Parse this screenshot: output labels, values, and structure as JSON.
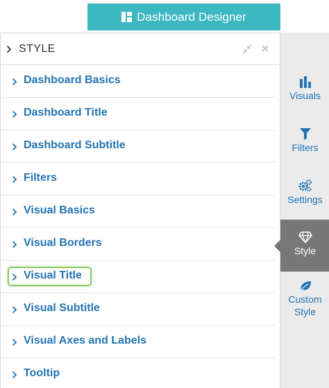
{
  "header": {
    "designer_label": "Dashboard Designer",
    "accent_color": "#3cb8c1"
  },
  "panel": {
    "title": "STYLE",
    "sections": [
      {
        "label": "Dashboard Basics"
      },
      {
        "label": "Dashboard Title"
      },
      {
        "label": "Dashboard Subtitle"
      },
      {
        "label": "Filters"
      },
      {
        "label": "Visual Basics"
      },
      {
        "label": "Visual Borders"
      },
      {
        "label": "Visual Title"
      },
      {
        "label": "Visual Subtitle"
      },
      {
        "label": "Visual Axes and Labels"
      },
      {
        "label": "Tooltip"
      }
    ],
    "highlighted_section": "Visual Title",
    "link_color": "#2374b3"
  },
  "nav": {
    "items": [
      {
        "label": "Visuals",
        "icon": "bar-chart-icon"
      },
      {
        "label": "Filters",
        "icon": "funnel-icon"
      },
      {
        "label": "Settings",
        "icon": "gears-icon"
      },
      {
        "label": "Style",
        "icon": "diamond-icon",
        "active": true
      },
      {
        "label": "Custom Style",
        "icon": "leaf-icon"
      }
    ],
    "active_color": "#777777"
  }
}
